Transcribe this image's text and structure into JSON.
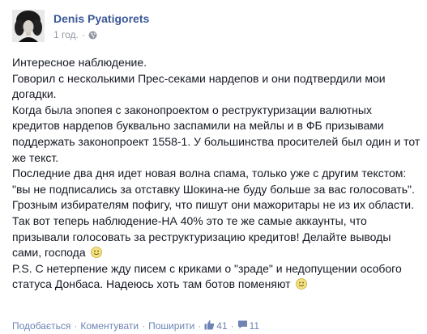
{
  "post": {
    "author": "Denis Pyatigorets",
    "time": "1 год.",
    "time_sep": "·",
    "paragraphs": [
      "Интересное наблюдение.",
      "Говорил с несколькими Прес-секами нардепов и они подтвердили мои догадки.",
      "Когда была эпопея с законопроектом о реструктуризации валютных кредитов нардепов буквально заспамили на мейлы и в ФБ призывами поддержать законопроект 1558-1. У большинства просителей был один и тот же текст.",
      "Последние два дня идет новая волна спама, только уже с другим текстом: \"вы не подписались за отставку Шокина-не буду больше за вас голосовать\". Грозным избирателям пофигу, что пишут они мажоритары не из их области. Так вот теперь наблюдение-НА 40% это те же самые аккаунты, что призывали голосовать за реструктуризацию кредитов! Делайте выводы сами, господа",
      "P.S. С нетерпение жду писем с криками о \"зраде\" и недопущении особого статуса Донбаса. Надеюсь хоть там ботов поменяют"
    ]
  },
  "footer": {
    "like_label": "Подобається",
    "comment_label": "Коментувати",
    "share_label": "Поширити",
    "separator": "·",
    "likes_count": "41",
    "comments_count": "11"
  },
  "colors": {
    "link": "#3b5998",
    "action_link": "#6d84b4",
    "meta": "#9197a3",
    "text": "#141823"
  },
  "icons": [
    "avatar",
    "globe-icon",
    "smile-emoji-icon",
    "thumbs-up-icon",
    "comment-icon"
  ]
}
